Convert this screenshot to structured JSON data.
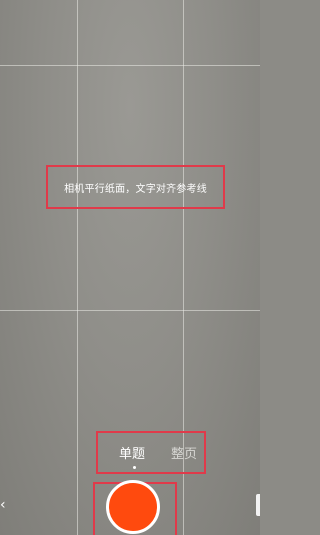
{
  "camera": {
    "hint": "相机平行纸面，文字对齐参考线"
  },
  "modes": {
    "items": [
      {
        "label": "单题",
        "selected": true
      },
      {
        "label": "整页",
        "selected": false
      }
    ]
  },
  "controls": {
    "shutter_color": "#ff4a0e",
    "annotation_color": "#e03a4a",
    "left_icon": "chevron-left-icon",
    "right_icon": "side-tab-icon"
  }
}
